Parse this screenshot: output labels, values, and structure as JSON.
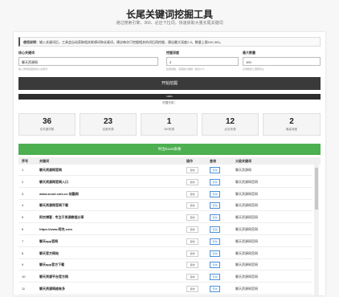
{
  "header": {
    "title": "长尾关键词挖掘工具",
    "subtitle": "通过搜索引擎，360、必应下拉词，快速获取大量长尾关键词"
  },
  "notice": {
    "prefix": "使用说明：",
    "text": "输入关键词后，工具会自动获取相关联想词和长尾词，建议每次只挖掘相关的词后再挖掘，建议最大深度2-3，数量上限100-300。"
  },
  "form": {
    "keyword_label": "核心关键词",
    "keyword_value": "聊天资源网",
    "keyword_hint": "输入你想挖掘的核心关键词",
    "depth_label": "挖掘深度",
    "depth_value": "2",
    "depth_hint": "挖掘层数，深度越大越慢（建议2-3）",
    "max_label": "最大数量",
    "max_value": "100",
    "max_hint": "达到数量上限即停止"
  },
  "start_button": "开始挖掘",
  "progress": {
    "percent": 100,
    "label": "100%",
    "status": "挖掘完成！"
  },
  "stats": [
    {
      "value": "36",
      "label": "总关键词数"
    },
    {
      "value": "23",
      "label": "百度来源"
    },
    {
      "value": "1",
      "label": "360来源"
    },
    {
      "value": "12",
      "label": "必应来源"
    },
    {
      "value": "2",
      "label": "最高深度"
    }
  ],
  "export_button": "导出Excel表格",
  "table": {
    "headers": {
      "num": "序号",
      "keyword": "关键词",
      "action": "操作",
      "query": "查询",
      "source": "父级关键词"
    },
    "rows": [
      {
        "num": "1",
        "keyword": "聊天资源网官网",
        "action": "复制",
        "query": "查询",
        "source": "聊天资源网"
      },
      {
        "num": "2",
        "keyword": "聊天资源网官网入口",
        "action": "复制",
        "query": "查询",
        "source": "聊天资源网官网"
      },
      {
        "num": "3",
        "keyword": "www.zcool.com.cn 站酷网",
        "action": "复制",
        "query": "查询",
        "source": "聊天资源网官网"
      },
      {
        "num": "4",
        "keyword": "聊天资源网官网下载",
        "action": "复制",
        "query": "查询",
        "source": "聊天资源网官网"
      },
      {
        "num": "5",
        "keyword": "阿杰博客 - 专注于资源教程分享",
        "action": "复制",
        "query": "查询",
        "source": "聊天资源网官网"
      },
      {
        "num": "6",
        "keyword": "https://www.阿杰.com",
        "action": "复制",
        "query": "查询",
        "source": "聊天资源网官网"
      },
      {
        "num": "7",
        "keyword": "聊天app官网",
        "action": "复制",
        "query": "查询",
        "source": "聊天资源网官网"
      },
      {
        "num": "8",
        "keyword": "聊天官方网站",
        "action": "复制",
        "query": "查询",
        "source": "聊天资源网官网"
      },
      {
        "num": "9",
        "keyword": "聊天app官方下载",
        "action": "复制",
        "query": "查询",
        "source": "聊天资源网官网"
      },
      {
        "num": "10",
        "keyword": "聊天资源平台官方网",
        "action": "复制",
        "query": "查询",
        "source": "聊天资源网官网"
      },
      {
        "num": "11",
        "keyword": "聊天资源网络有多",
        "action": "复制",
        "query": "查询",
        "source": "聊天资源网官网"
      }
    ]
  }
}
